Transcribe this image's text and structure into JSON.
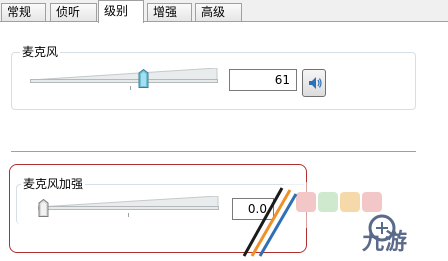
{
  "tabs": [
    {
      "label": "常规",
      "active": false
    },
    {
      "label": "侦听",
      "active": false
    },
    {
      "label": "级别",
      "active": true
    },
    {
      "label": "增强",
      "active": false
    },
    {
      "label": "高级",
      "active": false
    }
  ],
  "microphone": {
    "group_title": "麦克风",
    "value": "61",
    "level_fraction": 0.61
  },
  "mic_boost": {
    "group_title": "麦克风加强",
    "value": "0.0",
    "level_fraction": 0.0
  },
  "watermark": {
    "text": "九游"
  },
  "colors": {
    "highlight_frame": "#b03030",
    "slider_thumb": "#6fc1d8",
    "speaker_icon": "#2f6fb5"
  }
}
